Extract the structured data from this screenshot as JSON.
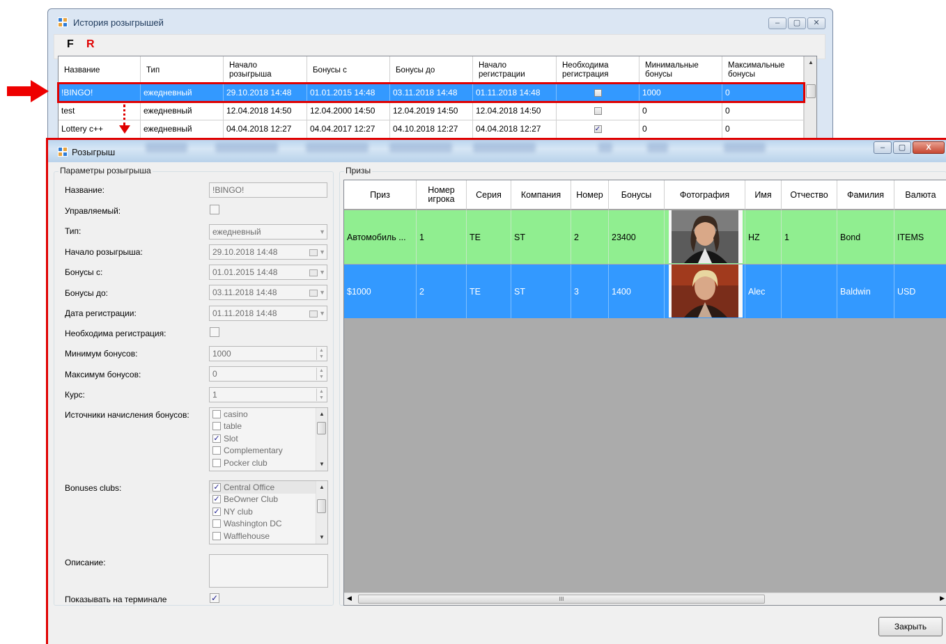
{
  "history_window": {
    "title": "История розыгрышей",
    "controls": [
      "‒",
      "▢",
      "✕"
    ],
    "toolbar": {
      "f_label": "F",
      "r_label": "R"
    },
    "columns": [
      "Название",
      "Тип",
      "Начало розыгрыша",
      "Бонусы с",
      "Бонусы до",
      "Начало регистрации",
      "Необходима регистрация",
      "Минимальные бонусы",
      "Максимальные бонусы"
    ],
    "rows": [
      {
        "name": "!BINGO!",
        "type": "ежедневный",
        "start": "29.10.2018 14:48",
        "bonus_from": "01.01.2015 14:48",
        "bonus_to": "03.11.2018 14:48",
        "reg_start": "01.11.2018 14:48",
        "reg_required": false,
        "min": "1000",
        "max": "0",
        "selected": true
      },
      {
        "name": "test",
        "type": "ежедневный",
        "start": "12.04.2018 14:50",
        "bonus_from": "12.04.2000 14:50",
        "bonus_to": "12.04.2019 14:50",
        "reg_start": "12.04.2018 14:50",
        "reg_required": false,
        "min": "0",
        "max": "0",
        "selected": false
      },
      {
        "name": "Lottery c++",
        "type": "ежедневный",
        "start": "04.04.2018 12:27",
        "bonus_from": "04.04.2017 12:27",
        "bonus_to": "04.10.2018 12:27",
        "reg_start": "04.04.2018 12:27",
        "reg_required": true,
        "min": "0",
        "max": "0",
        "selected": false
      }
    ]
  },
  "draw_window": {
    "title": "Розыгрыш",
    "controls": [
      "‒",
      "▢",
      "X"
    ],
    "params": {
      "group_title": "Параметры розыгрыша",
      "name_label": "Название:",
      "name_value": "!BINGO!",
      "managed_label": "Управляемый:",
      "managed_checked": false,
      "type_label": "Тип:",
      "type_value": "ежедневный",
      "start_label": "Начало розыгрыша:",
      "start_value": "29.10.2018 14:48",
      "bonus_from_label": "Бонусы с:",
      "bonus_from_value": "01.01.2015 14:48",
      "bonus_to_label": "Бонусы до:",
      "bonus_to_value": "03.11.2018 14:48",
      "reg_date_label": "Дата регистрации:",
      "reg_date_value": "01.11.2018 14:48",
      "reg_required_label": "Необходима регистрация:",
      "reg_required_checked": false,
      "min_label": "Минимум бонусов:",
      "min_value": "1000",
      "max_label": "Максимум бонусов:",
      "max_value": "0",
      "rate_label": "Курс:",
      "rate_value": "1",
      "sources_label": "Источники начисления бонусов:",
      "sources": [
        {
          "label": "casino",
          "checked": false
        },
        {
          "label": "table",
          "checked": false
        },
        {
          "label": "Slot",
          "checked": true
        },
        {
          "label": "Complementary",
          "checked": false
        },
        {
          "label": "Pocker club",
          "checked": false
        }
      ],
      "clubs_label": "Bonuses clubs:",
      "clubs": [
        {
          "label": "Central Office",
          "checked": true
        },
        {
          "label": "BeOwner Club",
          "checked": true
        },
        {
          "label": "NY club",
          "checked": true
        },
        {
          "label": "Washington DC",
          "checked": false
        },
        {
          "label": "Wafflehouse",
          "checked": false
        }
      ],
      "description_label": "Описание:",
      "show_terminal_label": "Показывать на терминале",
      "show_terminal_checked": true
    },
    "prizes": {
      "group_title": "Призы",
      "columns": [
        "Приз",
        "Номер игрока",
        "Серия",
        "Компания",
        "Номер",
        "Бонусы",
        "Фотография",
        "Имя",
        "Отчество",
        "Фамилия",
        "Валюта"
      ],
      "rows": [
        {
          "prize": "Автомобиль ...",
          "player": "1",
          "series": "TE",
          "company": "ST",
          "number": "2",
          "bonuses": "23400",
          "photo": "portrait-dark-hair",
          "first": "HZ",
          "middle": "1",
          "last": "Bond",
          "currency": "ITEMS",
          "color": "#90ee90"
        },
        {
          "prize": "$1000",
          "player": "2",
          "series": "TE",
          "company": "ST",
          "number": "3",
          "bonuses": "1400",
          "photo": "portrait-blond-hair",
          "first": "Alec",
          "middle": "",
          "last": "Baldwin",
          "currency": "USD",
          "color": "#3399ff"
        }
      ],
      "scroll_mark": "III"
    },
    "close_button": "Закрыть"
  },
  "colors": {
    "accent": "#3399ff",
    "highlight": "#e00000",
    "green_row": "#90ee90"
  },
  "icons": {
    "check": "✓",
    "up": "▲",
    "down": "▼",
    "left": "◀",
    "right": "▶"
  }
}
